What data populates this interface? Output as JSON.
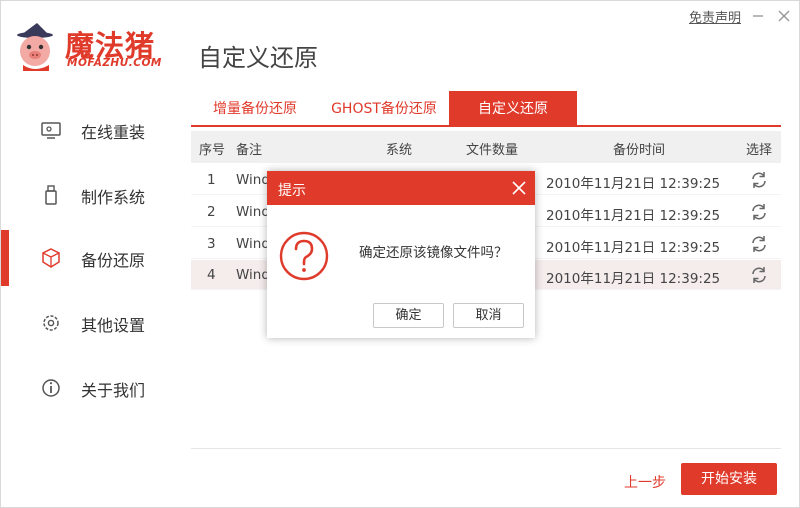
{
  "header": {
    "logo_main": "魔法猪",
    "logo_sub": "MOFAZHU.COM",
    "page_title": "自定义还原",
    "disclaimer": "免责声明",
    "minimize_icon": "minimize-icon",
    "close_icon": "close-icon"
  },
  "sidebar": {
    "items": [
      {
        "label": "在线重装",
        "icon": "monitor-icon",
        "active": false
      },
      {
        "label": "制作系统",
        "icon": "usb-icon",
        "active": false
      },
      {
        "label": "备份还原",
        "icon": "cube-icon",
        "active": true
      },
      {
        "label": "其他设置",
        "icon": "gear-icon",
        "active": false
      },
      {
        "label": "关于我们",
        "icon": "info-icon",
        "active": false
      }
    ]
  },
  "tabs": [
    {
      "label": "增量备份还原",
      "active": false
    },
    {
      "label": "GHOST备份还原",
      "active": false
    },
    {
      "label": "自定义还原",
      "active": true
    }
  ],
  "table": {
    "columns": [
      "序号",
      "备注",
      "系统",
      "文件数量",
      "备份时间",
      "选择"
    ],
    "rows": [
      {
        "index": "1",
        "note": "Wind",
        "time": "2010年11月21日 12:39:25"
      },
      {
        "index": "2",
        "note": "Wind",
        "time": "2010年11月21日 12:39:25"
      },
      {
        "index": "3",
        "note": "Wind",
        "time": "2010年11月21日 12:39:25"
      },
      {
        "index": "4",
        "note": "Wind",
        "time": "2010年11月21日 12:39:25"
      }
    ],
    "selected_row": 4
  },
  "footer": {
    "prev_label": "上一步",
    "install_label": "开始安装"
  },
  "dialog": {
    "title": "提示",
    "message": "确定还原该镜像文件吗？",
    "ok_label": "确定",
    "cancel_label": "取消",
    "icon": "question-icon"
  },
  "colors": {
    "accent": "#e03a2b",
    "selected_row": "#f5ecec",
    "table_header": "#f0f0f0"
  }
}
